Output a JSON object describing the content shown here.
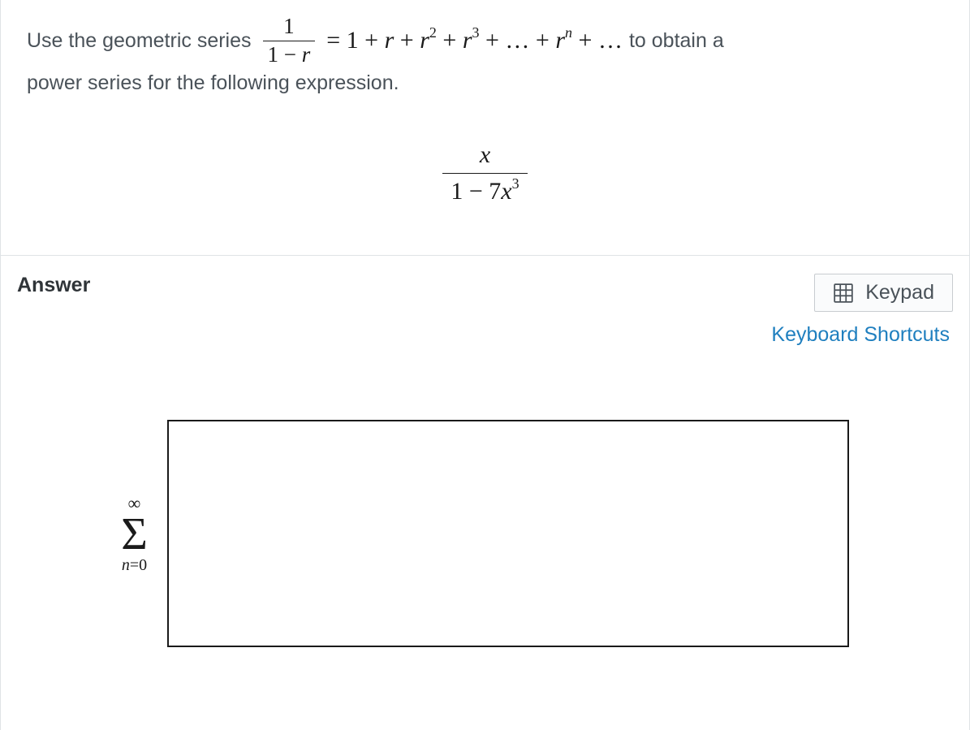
{
  "question": {
    "prefix": "Use the geometric series",
    "frac_num": "1",
    "frac_den_left": "1 − ",
    "frac_den_var": "r",
    "equals": " = 1 + ",
    "series_r": "r",
    "plus1": " + ",
    "series_r2_base": "r",
    "series_r2_exp": "2",
    "plus2": " + ",
    "series_r3_base": "r",
    "series_r3_exp": "3",
    "plus3": " + … + ",
    "series_rn_base": "r",
    "series_rn_exp": "n",
    "plus4": " + …",
    "suffix": " to obtain a",
    "line2": "power series for the following expression.",
    "expr_num": "x",
    "expr_den_left": "1 − 7",
    "expr_den_var": "x",
    "expr_den_exp": "3"
  },
  "answer": {
    "label": "Answer",
    "keypad_label": "Keypad",
    "shortcuts_label": "Keyboard Shortcuts",
    "sigma_top": "∞",
    "sigma_symbol": "Σ",
    "sigma_bottom_var": "n",
    "sigma_bottom_rest": "=0",
    "input_value": ""
  }
}
